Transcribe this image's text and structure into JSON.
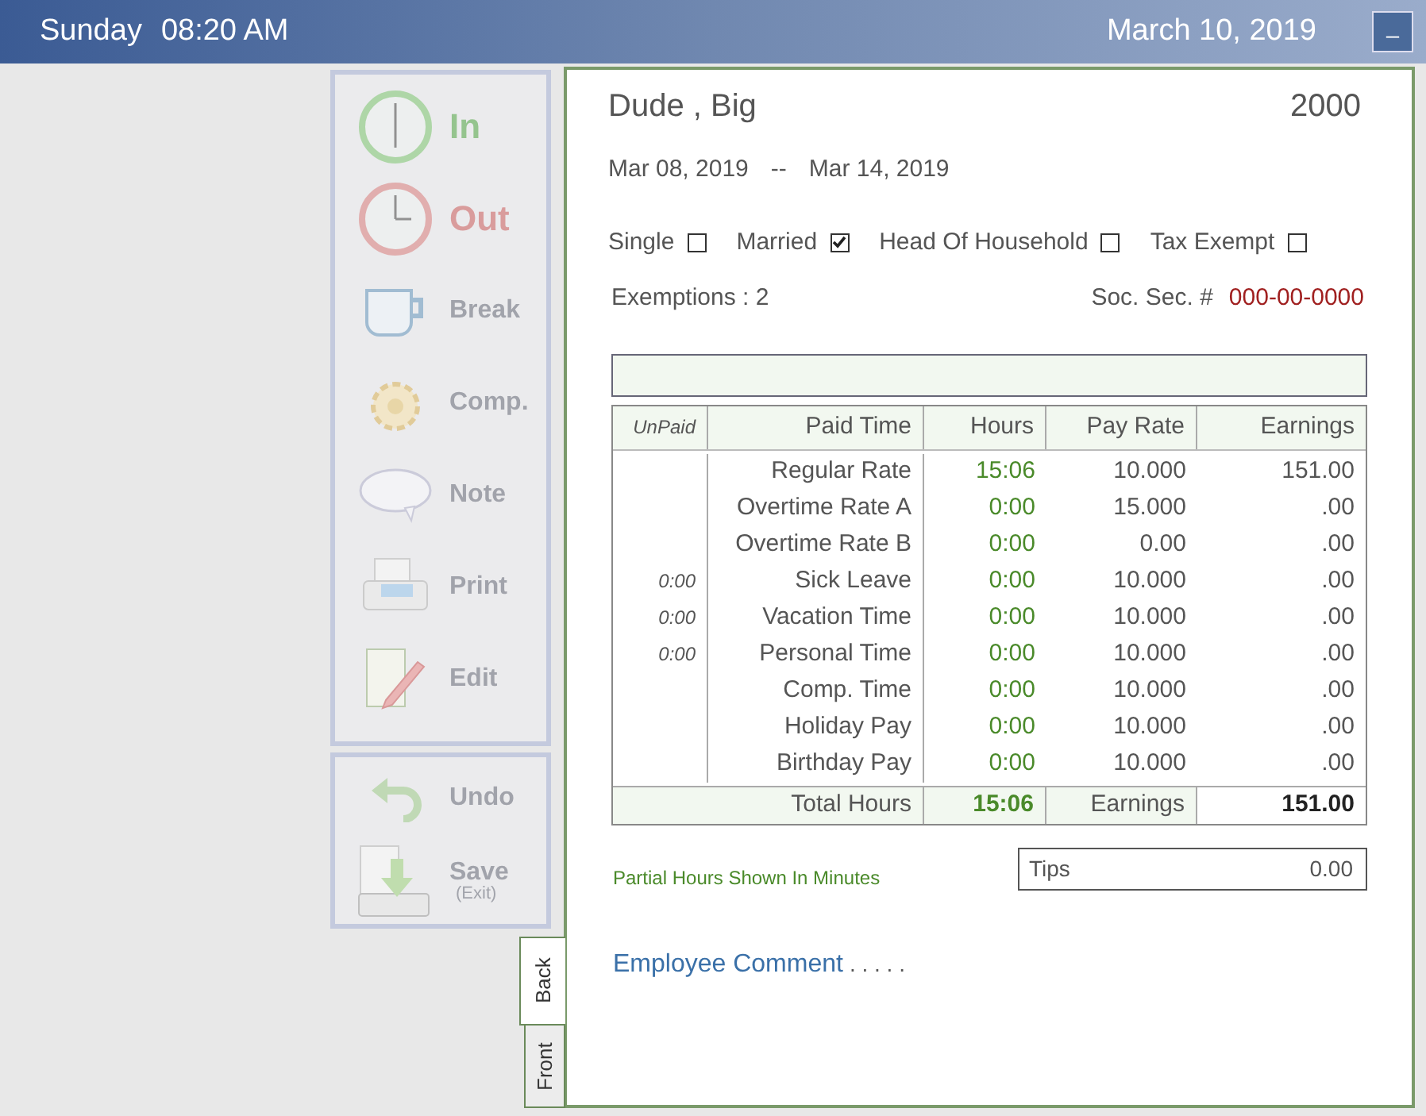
{
  "header": {
    "day": "Sunday",
    "time": "08:20 AM",
    "date": "March 10, 2019",
    "minimize": "_"
  },
  "actions": [
    {
      "kind": "in",
      "label": "In",
      "disabled": true
    },
    {
      "kind": "out",
      "label": "Out",
      "disabled": true
    },
    {
      "kind": "break",
      "label": "Break",
      "disabled": true
    },
    {
      "kind": "comp",
      "label": "Comp.",
      "disabled": true
    },
    {
      "kind": "note",
      "label": "Note",
      "disabled": true
    },
    {
      "kind": "print",
      "label": "Print",
      "disabled": true
    },
    {
      "kind": "edit",
      "label": "Edit",
      "disabled": true
    }
  ],
  "actions2": [
    {
      "kind": "undo",
      "label": "Undo",
      "disabled": true
    },
    {
      "kind": "save",
      "label": "Save",
      "sub": "(Exit)",
      "disabled": true
    }
  ],
  "employee": {
    "name": "Dude , Big",
    "number": "2000",
    "period_start": "Mar 08, 2019",
    "period_sep": "--",
    "period_end": "Mar 14, 2019"
  },
  "filing": [
    {
      "label": "Single",
      "checked": false
    },
    {
      "label": "Married",
      "checked": true
    },
    {
      "label": "Head Of Household",
      "checked": false
    },
    {
      "label": "Tax Exempt",
      "checked": false
    }
  ],
  "exemptions": "Exemptions : 2",
  "ssn_label": "Soc. Sec. #",
  "ssn": "000-00-0000",
  "table": {
    "columns": [
      "UnPaid",
      "Paid Time",
      "Hours",
      "Pay Rate",
      "Earnings"
    ],
    "rows": [
      [
        "",
        "Regular Rate",
        "15:06",
        "10.000",
        "151.00"
      ],
      [
        "",
        "Overtime Rate A",
        "0:00",
        "15.000",
        ".00"
      ],
      [
        "",
        "Overtime Rate B",
        "0:00",
        "0.00",
        ".00"
      ],
      [
        "0:00",
        "Sick Leave",
        "0:00",
        "10.000",
        ".00"
      ],
      [
        "0:00",
        "Vacation Time",
        "0:00",
        "10.000",
        ".00"
      ],
      [
        "0:00",
        "Personal Time",
        "0:00",
        "10.000",
        ".00"
      ],
      [
        "",
        "Comp. Time",
        "0:00",
        "10.000",
        ".00"
      ],
      [
        "",
        "Holiday Pay",
        "0:00",
        "10.000",
        ".00"
      ],
      [
        "",
        "Birthday Pay",
        "0:00",
        "10.000",
        ".00"
      ]
    ],
    "footer": {
      "label": "Total Hours",
      "hours": "15:06",
      "earnings_label": "Earnings",
      "earnings": "151.00"
    }
  },
  "note": "Partial Hours Shown In Minutes",
  "tips": {
    "label": "Tips",
    "value": "0.00"
  },
  "comment": {
    "label": "Employee Comment",
    "dots": ". . . . ."
  },
  "tabs": [
    {
      "label": "Back",
      "selected": true
    },
    {
      "label": "Front",
      "selected": false
    }
  ]
}
